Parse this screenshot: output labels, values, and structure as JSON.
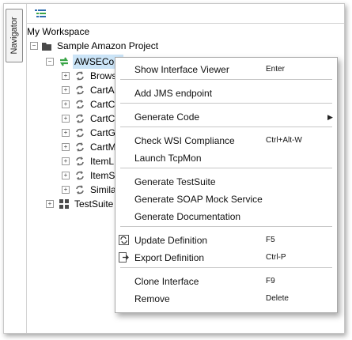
{
  "navigator": {
    "label": "Navigator"
  },
  "toolbar": {
    "icon": "list-view-icon"
  },
  "tree": {
    "root": "My Workspace",
    "project": "Sample Amazon Project",
    "interface": "AWSECommerceServiceBinding",
    "interface_visible": "AWSECom",
    "operations": [
      "Brows",
      "CartA",
      "CartC",
      "CartC",
      "CartG",
      "CartM",
      "ItemL",
      "ItemS",
      "Simila"
    ],
    "testsuite": "TestSuite"
  },
  "menu": {
    "items": [
      {
        "label": "Show Interface Viewer",
        "shortcut": "Enter"
      },
      {
        "label": "Add JMS endpoint",
        "shortcut": ""
      },
      {
        "label": "Generate Code",
        "shortcut": "",
        "submenu": true
      },
      {
        "label": "Check WSI Compliance",
        "shortcut": "Ctrl+Alt-W"
      },
      {
        "label": "Launch TcpMon",
        "shortcut": ""
      },
      {
        "label": "Generate TestSuite",
        "shortcut": ""
      },
      {
        "label": "Generate SOAP Mock Service",
        "shortcut": ""
      },
      {
        "label": "Generate Documentation",
        "shortcut": ""
      },
      {
        "label": "Update Definition",
        "shortcut": "F5",
        "icon": "update-definition-icon"
      },
      {
        "label": "Export Definition",
        "shortcut": "Ctrl-P",
        "icon": "export-icon"
      },
      {
        "label": "Clone Interface",
        "shortcut": "F9"
      },
      {
        "label": "Remove",
        "shortcut": "Delete"
      }
    ]
  },
  "colors": {
    "selection": "#cbe4f7",
    "interface_icon": "#3aa547",
    "folder": "#4a4a4a"
  }
}
